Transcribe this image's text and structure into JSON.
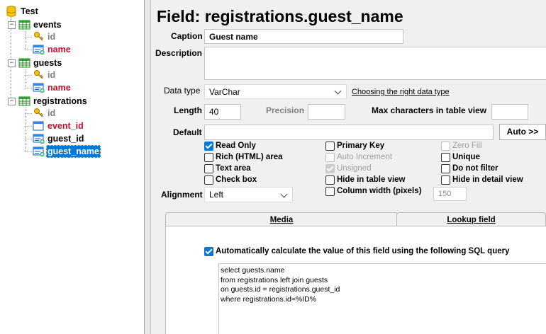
{
  "tree": {
    "root": "Test",
    "tables": [
      {
        "name": "events",
        "fields": [
          "id",
          "name"
        ]
      },
      {
        "name": "guests",
        "fields": [
          "id",
          "name"
        ]
      },
      {
        "name": "registrations",
        "fields": [
          "id",
          "event_id",
          "guest_id",
          "guest_name"
        ]
      }
    ]
  },
  "header": {
    "title": "Field: registrations.guest_name"
  },
  "form": {
    "caption_label": "Caption",
    "caption_value": "Guest name",
    "description_label": "Description",
    "description_value": "",
    "datatype_label": "Data type",
    "datatype_value": "VarChar",
    "datatype_link": "Choosing the right data type",
    "length_label": "Length",
    "length_value": "40",
    "precision_label": "Precision",
    "precision_value": "",
    "maxchars_label": "Max characters in table view",
    "maxchars_value": "",
    "default_label": "Default",
    "default_value": "",
    "auto_button": "Auto >>",
    "alignment_label": "Alignment",
    "alignment_value": "Left",
    "column_width_label": "Column width (pixels)",
    "column_width_value": "150"
  },
  "checkboxes": {
    "read_only": "Read Only",
    "rich_html": "Rich (HTML) area",
    "text_area": "Text area",
    "check_box": "Check box",
    "primary_key": "Primary Key",
    "auto_increment": "Auto Increment",
    "unsigned": "Unsigned",
    "hide_table": "Hide in table view",
    "zero_fill": "Zero Fill",
    "unique": "Unique",
    "do_not_filter": "Do not filter",
    "hide_detail": "Hide in detail view"
  },
  "tabs": {
    "media": "Media",
    "lookup": "Lookup field"
  },
  "sql": {
    "auto_calc_label": "Automatically calculate the value of this field using the following SQL query",
    "lines": [
      "select guests.name",
      "from registrations left join guests",
      "on guests.id = registrations.guest_id",
      "where registrations.id=%ID%"
    ]
  },
  "colors": {
    "selection": "#0078d7",
    "field_red": "#c8102e",
    "field_gray": "#808080"
  }
}
